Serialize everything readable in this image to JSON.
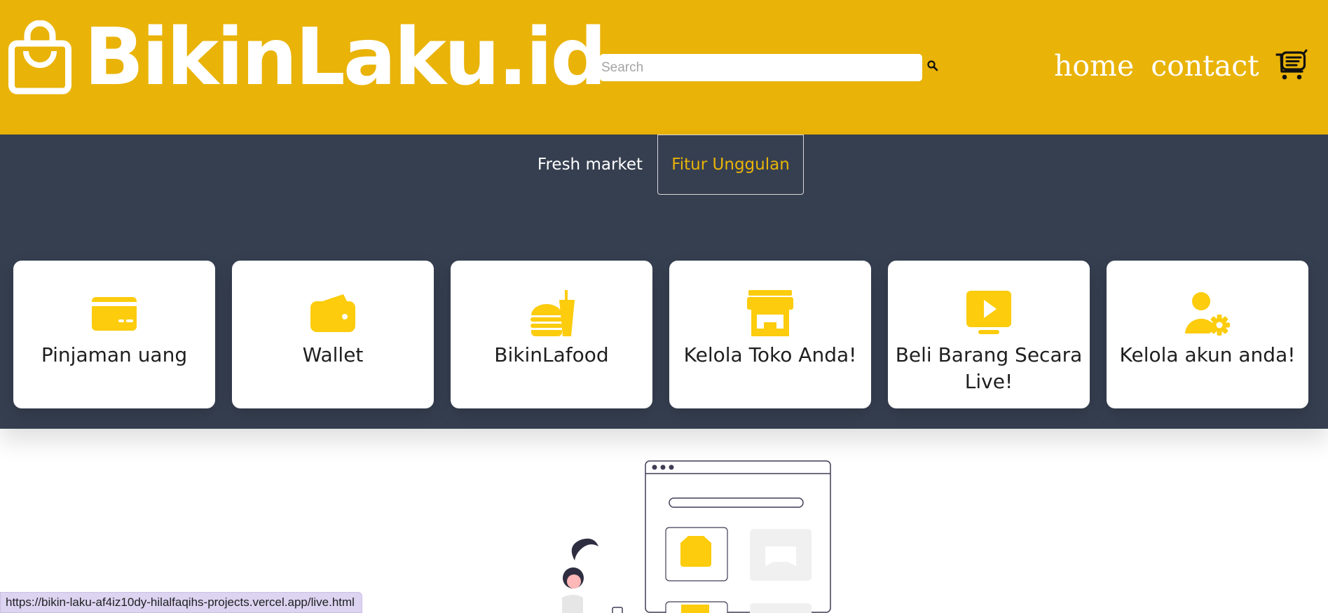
{
  "header": {
    "logo_text": "BikinLaku.id",
    "logo_icon": "shopping-bag-icon",
    "search": {
      "placeholder": "Search",
      "value": ""
    },
    "search_icon": "magnifier-icon",
    "nav": [
      {
        "label": "home"
      },
      {
        "label": "contact"
      }
    ],
    "cart_icon": "cart-icon"
  },
  "tabs": [
    {
      "label": "Fresh market",
      "active": false
    },
    {
      "label": "Fitur Unggulan",
      "active": true
    }
  ],
  "features": [
    {
      "label": "Pinjaman uang",
      "icon": "credit-card-icon"
    },
    {
      "label": "Wallet",
      "icon": "wallet-icon"
    },
    {
      "label": "BikinLafood",
      "icon": "burger-drink-icon"
    },
    {
      "label": "Kelola Toko Anda!",
      "icon": "store-icon"
    },
    {
      "label": "Beli Barang Secara Live!",
      "icon": "live-video-icon"
    },
    {
      "label": "Kelola akun anda!",
      "icon": "user-settings-icon"
    }
  ],
  "status_url": "https://bikin-laku-af4iz10dy-hilalfaqihs-projects.vercel.app/live.html",
  "colors": {
    "brand_yellow": "#e9b308",
    "icon_yellow": "#fccc0d",
    "band_dark": "#363f50",
    "card_white": "#ffffff"
  }
}
